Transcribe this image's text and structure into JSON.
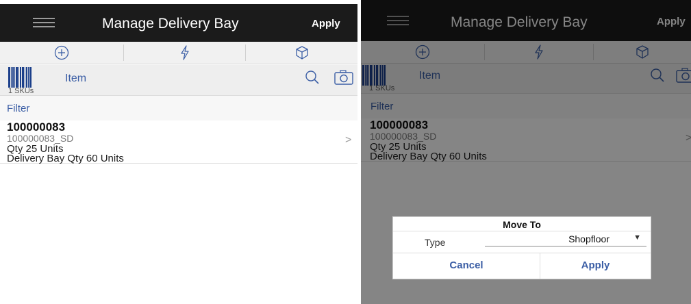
{
  "screens": [
    {
      "header": {
        "title": "Manage Delivery Bay",
        "apply": "Apply"
      },
      "toolbar": {
        "icons": [
          "add-icon",
          "flash-icon",
          "cube-icon"
        ]
      },
      "item_bar": {
        "label": "Item",
        "sku_count": "1 SKUs"
      },
      "filter": "Filter",
      "list": [
        {
          "item_number": "100000083",
          "item_id": "100000083_SD",
          "qty": "Qty 25 Units",
          "delivery_bay_qty": "Delivery Bay Qty 60 Units"
        }
      ]
    },
    {
      "header": {
        "title": "Manage Delivery Bay",
        "apply": "Apply"
      },
      "toolbar": {
        "icons": [
          "add-icon",
          "flash-icon",
          "cube-icon"
        ]
      },
      "item_bar": {
        "label": "Item",
        "sku_count": "1 SKUs"
      },
      "filter": "Filter",
      "list": [
        {
          "item_number": "100000083",
          "item_id": "100000083_SD",
          "qty": "Qty 25 Units",
          "delivery_bay_qty": "Delivery Bay Qty 60 Units"
        }
      ],
      "dialog": {
        "title": "Move To",
        "type_label": "Type",
        "type_value": "Shopfloor",
        "cancel": "Cancel",
        "apply": "Apply"
      }
    }
  ],
  "colors": {
    "header_bg": "#1b1b1b",
    "accent": "#3b5ea5",
    "barcode": "#1b3f8a"
  }
}
